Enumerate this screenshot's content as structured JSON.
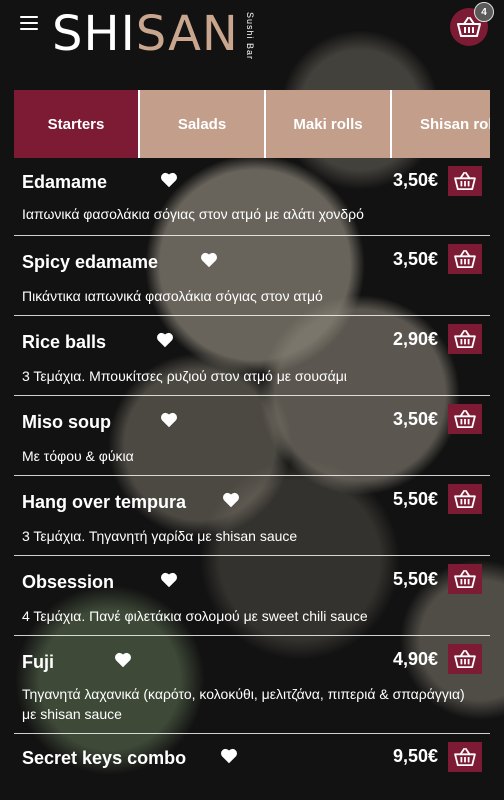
{
  "header": {
    "logo_shi": "SHI",
    "logo_san": "SAN",
    "logo_sub": "Sushi Bar",
    "cart_count": "4",
    "menu_icon": "hamburger-menu-icon",
    "cart_icon": "basket-icon"
  },
  "tabs": [
    {
      "label": "Starters",
      "active": true
    },
    {
      "label": "Salads",
      "active": false
    },
    {
      "label": "Maki rolls",
      "active": false
    },
    {
      "label": "Shisan rolls",
      "active": false
    }
  ],
  "items": [
    {
      "name": "Edamame",
      "price": "3,50€",
      "desc": "Ιαπωνικά φασολάκια σόγιας στον ατμό με αλάτι χονδρό"
    },
    {
      "name": "Spicy edamame",
      "price": "3,50€",
      "desc": "Πικάντικα ιαπωνικά φασολάκια σόγιας στον ατμό"
    },
    {
      "name": "Rice balls",
      "price": "2,90€",
      "desc": "3 Τεμάχια. Μπουκίτσες ρυζιού στον ατμό με σουσάμι"
    },
    {
      "name": "Miso soup",
      "price": "3,50€",
      "desc": "Με τόφου & φύκια"
    },
    {
      "name": "Hang over tempura",
      "price": "5,50€",
      "desc": "3 Τεμάχια. Τηγανητή γαρίδα με shisan sauce"
    },
    {
      "name": "Obsession",
      "price": "5,50€",
      "desc": "4 Τεμάχια. Πανέ φιλετάκια σολομού με sweet chili sauce"
    },
    {
      "name": "Fuji",
      "price": "4,90€",
      "desc": "Τηγανητά λαχανικά (καρότο, κολοκύθι, μελιτζάνα, πιπεριά & σπαράγγια) με shisan sauce"
    },
    {
      "name": "Secret keys combo",
      "price": "9,50€",
      "desc": ""
    }
  ],
  "colors": {
    "accent": "#7d1b35",
    "tab_bg": "#c29e8b",
    "logo_san": "#c9a78e"
  }
}
